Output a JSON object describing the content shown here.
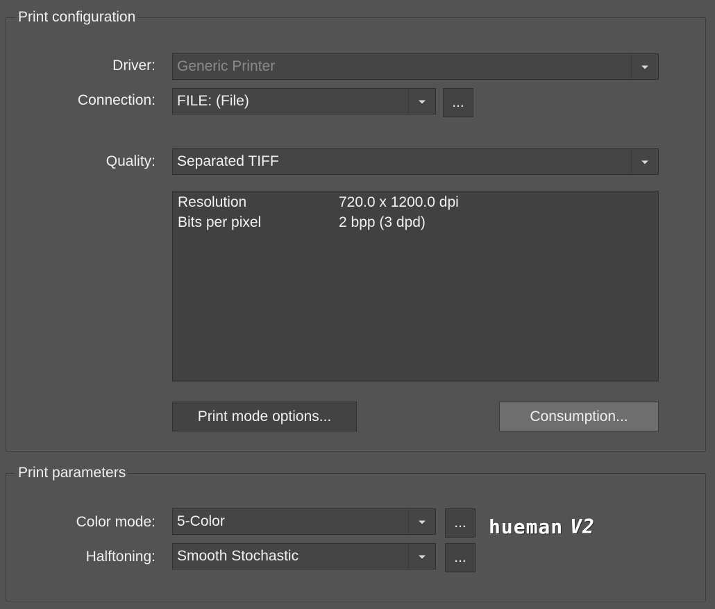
{
  "print_configuration": {
    "title": "Print configuration",
    "driver": {
      "label": "Driver:",
      "value": "Generic Printer"
    },
    "connection": {
      "label": "Connection:",
      "value": "FILE: (File)",
      "more_label": "..."
    },
    "quality": {
      "label": "Quality:",
      "value": "Separated TIFF"
    },
    "details": [
      {
        "key": "Resolution",
        "value": "720.0 x 1200.0 dpi"
      },
      {
        "key": "Bits per pixel",
        "value": "2 bpp (3 dpd)"
      }
    ],
    "print_mode_options_label": "Print mode options...",
    "consumption_label": "Consumption..."
  },
  "print_parameters": {
    "title": "Print parameters",
    "color_mode": {
      "label": "Color mode:",
      "value": "5-Color",
      "more_label": "..."
    },
    "halftoning": {
      "label": "Halftoning:",
      "value": "Smooth Stochastic",
      "more_label": "..."
    },
    "logo": {
      "name": "hueman",
      "version": "V2"
    }
  }
}
